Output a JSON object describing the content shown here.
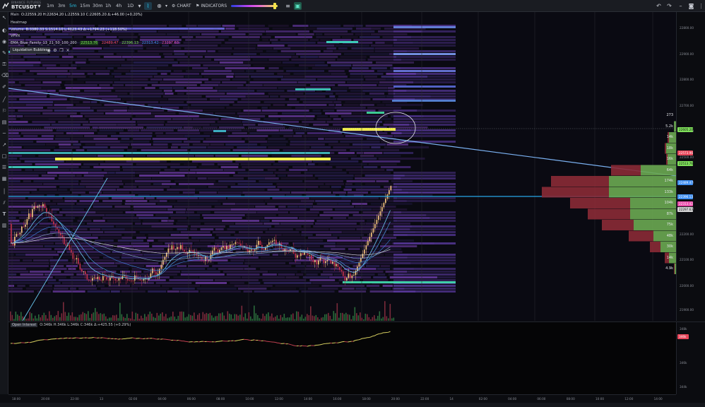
{
  "header": {
    "exchange": "BINANCE FUTURES",
    "symbol": "BTCUSDT",
    "timeframes": [
      "1m",
      "3m",
      "5m",
      "15m",
      "30m",
      "1h",
      "4h",
      "1D"
    ],
    "active_timeframe": "5m",
    "chart_label": "CHART",
    "indicators_label": "INDICATORS"
  },
  "legend": {
    "main": {
      "label": "Main",
      "ohlc": "O:22559.20 H:22634.20 L:22559.10 C:22605.20 Δ:+46.00 (+0.20%)"
    },
    "heatmap": {
      "label": "Heatmap"
    },
    "volume": {
      "label": "Volume",
      "values": "B:3380.33 S:1514.10 L:4023.43 Δ:+1794.23 (+118.50%)"
    },
    "vpvr": {
      "label": "VPVR"
    },
    "ema": {
      "label": "EMA_Blue_Family_13_21_50_100_200",
      "v1": "22513.76",
      "v2": "22489.47",
      "v3": "22396.13",
      "v4": "22313.42",
      "v5": "22297.63"
    },
    "liquidation": {
      "label": "Liquidation Bubbles"
    }
  },
  "price_axis": {
    "labels": [
      "22800.00",
      "22900.00",
      "22800.00",
      "22700.00",
      "22600.00",
      "22500.00",
      "22400.00",
      "22300.00",
      "22200.00",
      "22100.00",
      "22000.00",
      "21900.00"
    ],
    "tags": [
      {
        "text": "22605.20",
        "color": "#7fe05a"
      },
      {
        "text": "22573.96",
        "color": "#e8465a"
      },
      {
        "text": "22513.76",
        "color": "#7fe05a"
      },
      {
        "text": "22489.47",
        "color": "#3f8ef0"
      },
      {
        "text": "22396.13",
        "color": "#3f8ef0"
      },
      {
        "text": "22313.42",
        "color": "#e84aa8"
      },
      {
        "text": "22297.63",
        "color": "#d6d6d6"
      }
    ]
  },
  "vpvr": {
    "labels": [
      "273",
      "5.2k",
      "14k",
      "18k",
      "16k",
      "64k",
      "174k",
      "133k",
      "104k",
      "87k",
      "75k",
      "48k",
      "30k",
      "14k",
      "4.9k"
    ],
    "rows": [
      {
        "buy": 0,
        "sell": 0
      },
      {
        "buy": 3,
        "sell": 0
      },
      {
        "buy": 10,
        "sell": 2
      },
      {
        "buy": 14,
        "sell": 2
      },
      {
        "buy": 12,
        "sell": 2
      },
      {
        "buy": 50,
        "sell": 42
      },
      {
        "buy": 95,
        "sell": 82
      },
      {
        "buy": 95,
        "sell": 95
      },
      {
        "buy": 65,
        "sell": 85
      },
      {
        "buy": 65,
        "sell": 60
      },
      {
        "buy": 60,
        "sell": 45
      },
      {
        "buy": 32,
        "sell": 35
      },
      {
        "buy": 22,
        "sell": 15
      },
      {
        "buy": 10,
        "sell": 6
      },
      {
        "buy": 2,
        "sell": 1
      }
    ]
  },
  "open_interest": {
    "label": "Open Interest",
    "values": "O:346k H:346k L:346k C:346k Δ:+425.55 (+0.29%)",
    "axis": [
      "348k",
      "346k",
      "344k"
    ],
    "current": "346k"
  },
  "time_axis": [
    "18:00",
    "20:00",
    "22:00",
    "13",
    "02:00",
    "04:00",
    "06:00",
    "08:00",
    "10:00",
    "12:00",
    "14:00",
    "16:00",
    "18:00",
    "20:00",
    "22:00",
    "14",
    "02:00",
    "04:00",
    "06:00",
    "08:00",
    "10:00",
    "12:00",
    "14:00"
  ]
}
